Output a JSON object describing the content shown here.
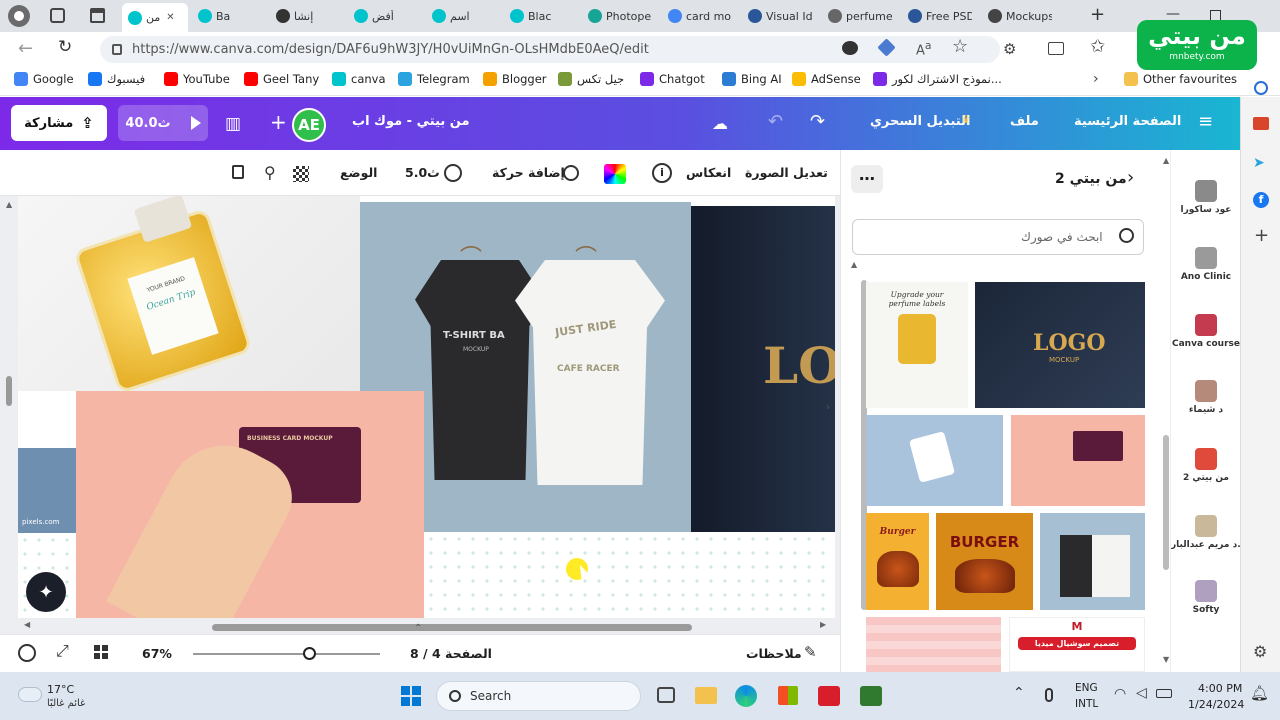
{
  "browser": {
    "tabs": [
      {
        "label": "من",
        "color": "#00c4cc",
        "active": true
      },
      {
        "label": "Ba",
        "color": "#00c4cc"
      },
      {
        "label": "إنشا",
        "color": "#333333"
      },
      {
        "label": "أفض",
        "color": "#00c4cc"
      },
      {
        "label": "اسم",
        "color": "#00c4cc"
      },
      {
        "label": "Blac",
        "color": "#00c4cc"
      },
      {
        "label": "Photope",
        "color": "#18a497"
      },
      {
        "label": "card mo",
        "color": "#4285f4"
      },
      {
        "label": "Visual Id",
        "color": "#2b579a"
      },
      {
        "label": "perfume",
        "color": "#666666"
      },
      {
        "label": "Free PSD",
        "color": "#2b579a"
      },
      {
        "label": "Mockups",
        "color": "#444444"
      }
    ],
    "url": "https://www.canva.com/design/DAF6u9hW3JY/H0vUiMnGn-OLsHMdbE0AeQ/edit",
    "bookmarks": [
      {
        "label": "Google",
        "color": "#4285f4"
      },
      {
        "label": "فيسبوك",
        "color": "#1877f2"
      },
      {
        "label": "YouTube",
        "color": "#ff0000"
      },
      {
        "label": "Geel Tany",
        "color": "#ff0000"
      },
      {
        "label": "canva",
        "color": "#00c4cc"
      },
      {
        "label": "Telegram",
        "color": "#2aa3df"
      },
      {
        "label": "Blogger",
        "color": "#f4a100"
      },
      {
        "label": "جيل تكس",
        "color": "#7a9a3a"
      },
      {
        "label": "Chatgot",
        "color": "#7d2ae8"
      },
      {
        "label": "Bing AI",
        "color": "#2b7cd3"
      },
      {
        "label": "AdSense",
        "color": "#fbbc04"
      },
      {
        "label": "نموذج الاشتراك لكور...",
        "color": "#7d2ae8"
      }
    ],
    "other_favourites": "Other favourites"
  },
  "watermark": {
    "text": "من بيتي",
    "sub": "mnbety.com"
  },
  "canva": {
    "menu": {
      "home": "الصفحة الرئيسية",
      "file": "ملف",
      "magic": "التبديل السحري"
    },
    "title": "من بيتي - موك اب",
    "avatar": "AE",
    "present": "40.0ث",
    "share": "مشاركة",
    "toolbar": {
      "edit_image": "تعديل الصورة",
      "flip": "انعكاس",
      "animate": "إضافة حركة",
      "duration": "5.0ث",
      "position": "الوضع"
    },
    "bottom": {
      "notes": "ملاحظات",
      "page": "الصفحة 4 / 8",
      "zoom": "67%",
      "zoom_level": 0.62
    },
    "panel": {
      "title": "من بيتي 2",
      "search_placeholder": "ابحث في صورك"
    },
    "rail": [
      {
        "label": "عود ساكورا",
        "color": "#8a8a8a"
      },
      {
        "label": "Ano Clinic",
        "color": "#9a9a9a"
      },
      {
        "label": "Canva course",
        "color": "#c43a4f"
      },
      {
        "label": "د شيماء",
        "color": "#b58a7a"
      },
      {
        "label": "من بيتي 2",
        "color": "#e04a3a"
      },
      {
        "label": "د مريم عبدالبار...",
        "color": "#c9b89a"
      },
      {
        "label": "Softy",
        "color": "#b0a0c0"
      }
    ],
    "mockups": {
      "perfume_brand": "YOUR BRAND",
      "perfume_name": "Ocean Trip",
      "tshirt_left": "T-SHIRT BA",
      "tshirt_left_sub": "MOCKUP",
      "tshirt_right": "JUST RIDE",
      "tshirt_right_sub": "CAFE RACER",
      "card": "BUSINESS CARD MOCKUP",
      "logo": "LO",
      "pixels": "pixels.com"
    },
    "thumbs": {
      "perfume_caption": "Upgrade your perfume labels",
      "logo": "LOGO",
      "logo_sub": "MOCKUP",
      "burger1": "Burger",
      "burger2": "BURGER",
      "social": "تصميم سوشيال ميديا"
    }
  },
  "taskbar": {
    "temp": "17°C",
    "weather": "غائم غالبًا",
    "search": "Search",
    "lang": "ENG",
    "lang2": "INTL",
    "time": "4:00 PM",
    "date": "1/24/2024"
  }
}
